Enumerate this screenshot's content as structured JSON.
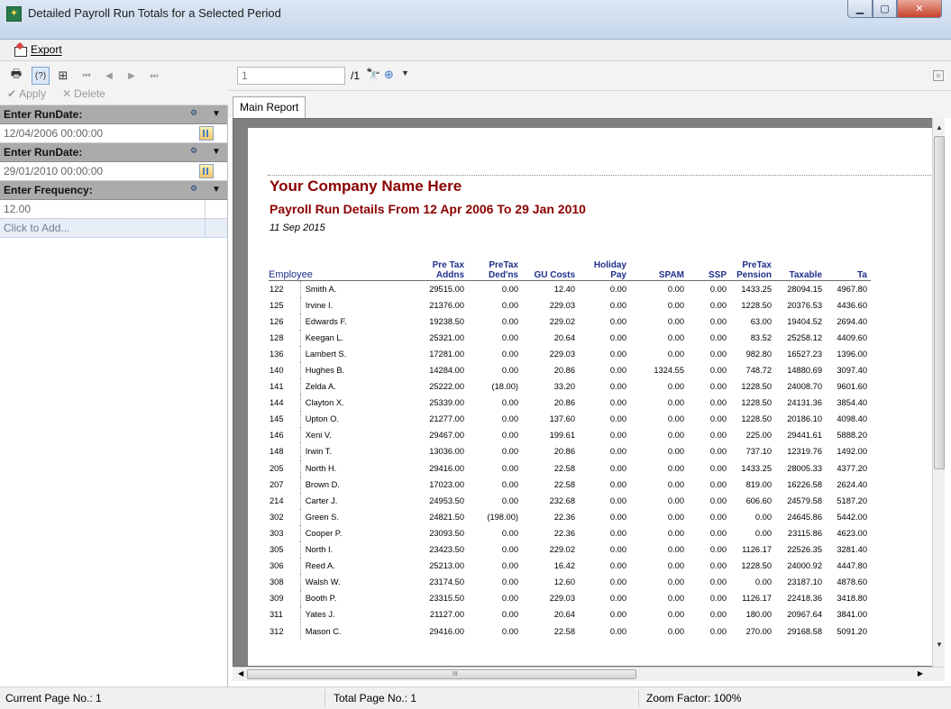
{
  "window": {
    "title": "Detailed Payroll Run Totals for a Selected Period"
  },
  "menu": {
    "export_label": "Export"
  },
  "left_toolbar": {
    "apply_label": "Apply",
    "delete_label": "Delete"
  },
  "params": [
    {
      "label": "Enter RunDate:",
      "value": "12/04/2006 00:00:00"
    },
    {
      "label": "Enter RunDate:",
      "value": "29/01/2010 00:00:00"
    },
    {
      "label": "Enter Frequency:",
      "value": "12.00"
    }
  ],
  "click_to_add": "Click to Add...",
  "viewer": {
    "page_input": "1",
    "page_total": "/1",
    "tab_label": "Main Report"
  },
  "report": {
    "company": "Your Company Name Here",
    "subtitle": "Payroll Run Details From  12 Apr 2006 To 29 Jan 2010",
    "date": "11 Sep 2015",
    "columns": [
      {
        "id": "employee",
        "label": "Employee"
      },
      {
        "id": "pretax_addns",
        "label": "Pre Tax\nAddns"
      },
      {
        "id": "pretax_dedns",
        "label": "PreTax\nDed'ns"
      },
      {
        "id": "gu_costs",
        "label": "GU Costs"
      },
      {
        "id": "holiday_pay",
        "label": "Holiday\nPay"
      },
      {
        "id": "spam",
        "label": "SPAM"
      },
      {
        "id": "ssp",
        "label": "SSP"
      },
      {
        "id": "pretax_pension",
        "label": "PreTax\nPension"
      },
      {
        "id": "taxable",
        "label": "Taxable"
      },
      {
        "id": "ta",
        "label": "Ta"
      }
    ],
    "rows": [
      [
        "122",
        "Smith A.",
        "29515.00",
        "0.00",
        "12.40",
        "0.00",
        "0.00",
        "0.00",
        "1433.25",
        "28094.15",
        "4967.80"
      ],
      [
        "125",
        "Irvine I.",
        "21376.00",
        "0.00",
        "229.03",
        "0.00",
        "0.00",
        "0.00",
        "1228.50",
        "20376.53",
        "4436.60"
      ],
      [
        "126",
        "Edwards F.",
        "19238.50",
        "0.00",
        "229.02",
        "0.00",
        "0.00",
        "0.00",
        "63.00",
        "19404.52",
        "2694.40"
      ],
      [
        "128",
        "Keegan L.",
        "25321.00",
        "0.00",
        "20.64",
        "0.00",
        "0.00",
        "0.00",
        "83.52",
        "25258.12",
        "4409.60"
      ],
      [
        "136",
        "Lambert S.",
        "17281.00",
        "0.00",
        "229.03",
        "0.00",
        "0.00",
        "0.00",
        "982.80",
        "16527.23",
        "1396.00"
      ],
      [
        "140",
        "Hughes B.",
        "14284.00",
        "0.00",
        "20.86",
        "0.00",
        "1324.55",
        "0.00",
        "748.72",
        "14880.69",
        "3097.40"
      ],
      [
        "141",
        "Zelda A.",
        "25222.00",
        "(18.00)",
        "33.20",
        "0.00",
        "0.00",
        "0.00",
        "1228.50",
        "24008.70",
        "9601.60"
      ],
      [
        "144",
        "Clayton X.",
        "25339.00",
        "0.00",
        "20.86",
        "0.00",
        "0.00",
        "0.00",
        "1228.50",
        "24131.36",
        "3854.40"
      ],
      [
        "145",
        "Upton O.",
        "21277.00",
        "0.00",
        "137.60",
        "0.00",
        "0.00",
        "0.00",
        "1228.50",
        "20186.10",
        "4098.40"
      ],
      [
        "146",
        "Xeni V.",
        "29467.00",
        "0.00",
        "199.61",
        "0.00",
        "0.00",
        "0.00",
        "225.00",
        "29441.61",
        "5888.20"
      ],
      [
        "148",
        "Irwin T.",
        "13036.00",
        "0.00",
        "20.86",
        "0.00",
        "0.00",
        "0.00",
        "737.10",
        "12319.76",
        "1492.00"
      ],
      [
        "205",
        "North H.",
        "29416.00",
        "0.00",
        "22.58",
        "0.00",
        "0.00",
        "0.00",
        "1433.25",
        "28005.33",
        "4377.20"
      ],
      [
        "207",
        "Brown D.",
        "17023.00",
        "0.00",
        "22.58",
        "0.00",
        "0.00",
        "0.00",
        "819.00",
        "16226.58",
        "2624.40"
      ],
      [
        "214",
        "Carter J.",
        "24953.50",
        "0.00",
        "232.68",
        "0.00",
        "0.00",
        "0.00",
        "606.60",
        "24579.58",
        "5187.20"
      ],
      [
        "302",
        "Green S.",
        "24821.50",
        "(198.00)",
        "22.36",
        "0.00",
        "0.00",
        "0.00",
        "0.00",
        "24645.86",
        "5442.00"
      ],
      [
        "303",
        "Cooper P.",
        "23093.50",
        "0.00",
        "22.36",
        "0.00",
        "0.00",
        "0.00",
        "0.00",
        "23115.86",
        "4623.00"
      ],
      [
        "305",
        "North I.",
        "23423.50",
        "0.00",
        "229.02",
        "0.00",
        "0.00",
        "0.00",
        "1126.17",
        "22526.35",
        "3281.40"
      ],
      [
        "306",
        "Reed A.",
        "25213.00",
        "0.00",
        "16.42",
        "0.00",
        "0.00",
        "0.00",
        "1228.50",
        "24000.92",
        "4447.80"
      ],
      [
        "308",
        "Walsh W.",
        "23174.50",
        "0.00",
        "12.60",
        "0.00",
        "0.00",
        "0.00",
        "0.00",
        "23187.10",
        "4878.60"
      ],
      [
        "309",
        "Booth P.",
        "23315.50",
        "0.00",
        "229.03",
        "0.00",
        "0.00",
        "0.00",
        "1126.17",
        "22418.36",
        "3418.80"
      ],
      [
        "311",
        "Yates J.",
        "21127.00",
        "0.00",
        "20.64",
        "0.00",
        "0.00",
        "0.00",
        "180.00",
        "20967.64",
        "3841.00"
      ],
      [
        "312",
        "Mason C.",
        "29416.00",
        "0.00",
        "22.58",
        "0.00",
        "0.00",
        "0.00",
        "270.00",
        "29168.58",
        "5091.20"
      ]
    ]
  },
  "status": {
    "current_page": "Current Page No.: 1",
    "total_page": "Total Page No.: 1",
    "zoom": "Zoom Factor: 100%"
  },
  "hscroll_grip": "III",
  "icons": {
    "print": "printer-icon",
    "help": "help-icon",
    "tree": "group-tree-icon",
    "first": "first-page-icon",
    "prev": "prev-page-icon",
    "next": "next-page-icon",
    "last": "last-page-icon",
    "find": "binoculars-icon",
    "zoom": "zoom-icon"
  },
  "colors": {
    "heading": "#8b0000",
    "column_header": "#1f2f8a",
    "param_header_bg": "#ababab"
  }
}
